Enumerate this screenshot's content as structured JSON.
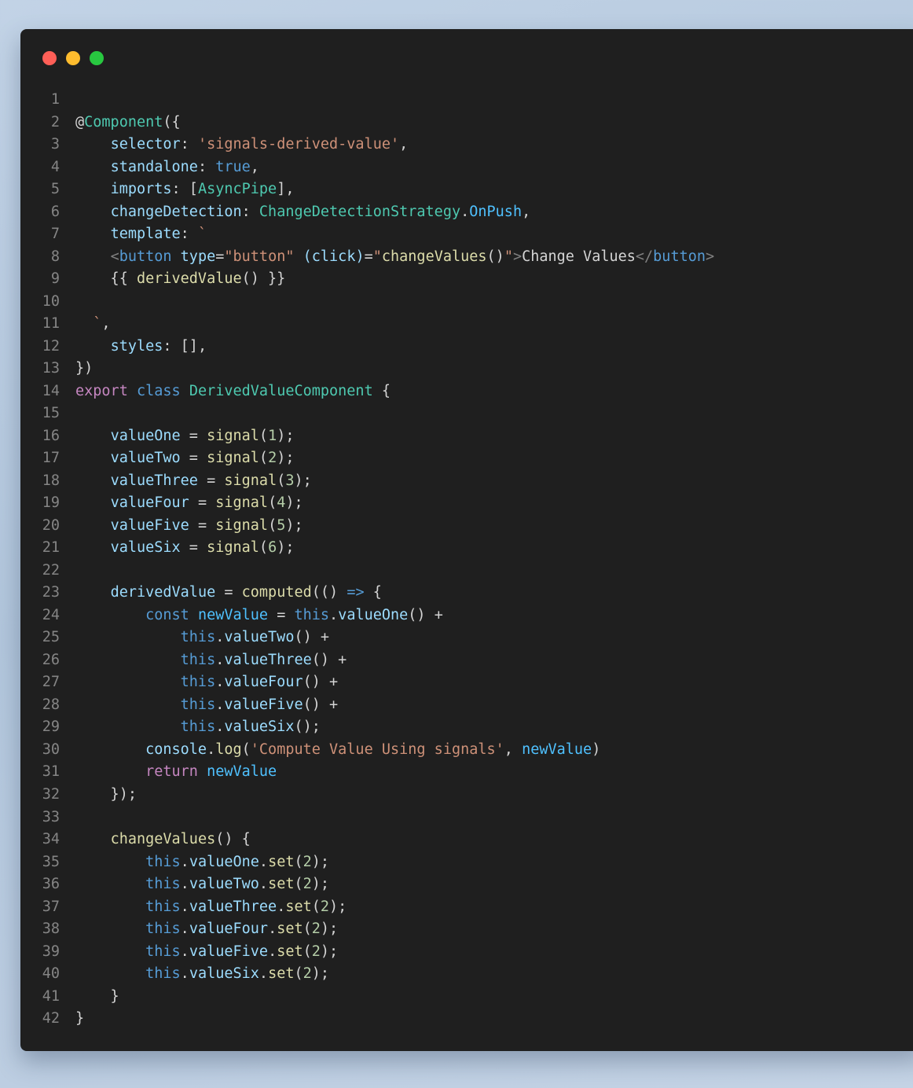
{
  "window": {
    "controls": [
      {
        "name": "close",
        "color": "#ff5f57"
      },
      {
        "name": "minimize",
        "color": "#febc2e"
      },
      {
        "name": "maximize",
        "color": "#28c840"
      }
    ]
  },
  "code": {
    "lines": [
      {
        "num": "1",
        "tokens": []
      },
      {
        "num": "2",
        "tokens": [
          [
            "text",
            "@"
          ],
          [
            "deco",
            "Component"
          ],
          [
            "text",
            "({"
          ]
        ]
      },
      {
        "num": "3",
        "tokens": [
          [
            "text",
            "    "
          ],
          [
            "prop",
            "selector"
          ],
          [
            "text",
            ": "
          ],
          [
            "str",
            "'signals-derived-value'"
          ],
          [
            "text",
            ","
          ]
        ]
      },
      {
        "num": "4",
        "tokens": [
          [
            "text",
            "    "
          ],
          [
            "prop",
            "standalone"
          ],
          [
            "text",
            ": "
          ],
          [
            "kw",
            "true"
          ],
          [
            "text",
            ","
          ]
        ]
      },
      {
        "num": "5",
        "tokens": [
          [
            "text",
            "    "
          ],
          [
            "prop",
            "imports"
          ],
          [
            "text",
            ": ["
          ],
          [
            "type",
            "AsyncPipe"
          ],
          [
            "text",
            "],"
          ]
        ]
      },
      {
        "num": "6",
        "tokens": [
          [
            "text",
            "    "
          ],
          [
            "prop",
            "changeDetection"
          ],
          [
            "text",
            ": "
          ],
          [
            "type",
            "ChangeDetectionStrategy"
          ],
          [
            "text",
            "."
          ],
          [
            "var",
            "OnPush"
          ],
          [
            "text",
            ","
          ]
        ]
      },
      {
        "num": "7",
        "tokens": [
          [
            "text",
            "    "
          ],
          [
            "prop",
            "template"
          ],
          [
            "text",
            ": "
          ],
          [
            "str",
            "`"
          ]
        ]
      },
      {
        "num": "8",
        "tokens": [
          [
            "text",
            "    "
          ],
          [
            "punct",
            "<"
          ],
          [
            "tag",
            "button"
          ],
          [
            "text",
            " "
          ],
          [
            "attr",
            "type"
          ],
          [
            "text",
            "="
          ],
          [
            "str",
            "\"button\""
          ],
          [
            "text",
            " "
          ],
          [
            "attr",
            "(click)"
          ],
          [
            "text",
            "="
          ],
          [
            "str",
            "\""
          ],
          [
            "fn",
            "changeValues"
          ],
          [
            "text",
            "()"
          ],
          [
            "str",
            "\""
          ],
          [
            "punct",
            ">"
          ],
          [
            "text",
            "Change Values"
          ],
          [
            "punct",
            "</"
          ],
          [
            "tag",
            "button"
          ],
          [
            "punct",
            ">"
          ]
        ]
      },
      {
        "num": "9",
        "tokens": [
          [
            "text",
            "    {{ "
          ],
          [
            "fn",
            "derivedValue"
          ],
          [
            "text",
            "() }}"
          ]
        ]
      },
      {
        "num": "10",
        "tokens": []
      },
      {
        "num": "11",
        "tokens": [
          [
            "text",
            "  "
          ],
          [
            "str",
            "`"
          ],
          [
            "text",
            ","
          ]
        ]
      },
      {
        "num": "12",
        "tokens": [
          [
            "text",
            "    "
          ],
          [
            "prop",
            "styles"
          ],
          [
            "text",
            ": [],"
          ]
        ]
      },
      {
        "num": "13",
        "tokens": [
          [
            "text",
            "})"
          ]
        ]
      },
      {
        "num": "14",
        "tokens": [
          [
            "kw2",
            "export"
          ],
          [
            "text",
            " "
          ],
          [
            "kw",
            "class"
          ],
          [
            "text",
            " "
          ],
          [
            "type",
            "DerivedValueComponent"
          ],
          [
            "text",
            " {"
          ]
        ]
      },
      {
        "num": "15",
        "tokens": []
      },
      {
        "num": "16",
        "tokens": [
          [
            "text",
            "    "
          ],
          [
            "prop",
            "valueOne"
          ],
          [
            "text",
            " = "
          ],
          [
            "fn",
            "signal"
          ],
          [
            "text",
            "("
          ],
          [
            "num",
            "1"
          ],
          [
            "text",
            ");"
          ]
        ]
      },
      {
        "num": "17",
        "tokens": [
          [
            "text",
            "    "
          ],
          [
            "prop",
            "valueTwo"
          ],
          [
            "text",
            " = "
          ],
          [
            "fn",
            "signal"
          ],
          [
            "text",
            "("
          ],
          [
            "num",
            "2"
          ],
          [
            "text",
            ");"
          ]
        ]
      },
      {
        "num": "18",
        "tokens": [
          [
            "text",
            "    "
          ],
          [
            "prop",
            "valueThree"
          ],
          [
            "text",
            " = "
          ],
          [
            "fn",
            "signal"
          ],
          [
            "text",
            "("
          ],
          [
            "num",
            "3"
          ],
          [
            "text",
            ");"
          ]
        ]
      },
      {
        "num": "19",
        "tokens": [
          [
            "text",
            "    "
          ],
          [
            "prop",
            "valueFour"
          ],
          [
            "text",
            " = "
          ],
          [
            "fn",
            "signal"
          ],
          [
            "text",
            "("
          ],
          [
            "num",
            "4"
          ],
          [
            "text",
            ");"
          ]
        ]
      },
      {
        "num": "20",
        "tokens": [
          [
            "text",
            "    "
          ],
          [
            "prop",
            "valueFive"
          ],
          [
            "text",
            " = "
          ],
          [
            "fn",
            "signal"
          ],
          [
            "text",
            "("
          ],
          [
            "num",
            "5"
          ],
          [
            "text",
            ");"
          ]
        ]
      },
      {
        "num": "21",
        "tokens": [
          [
            "text",
            "    "
          ],
          [
            "prop",
            "valueSix"
          ],
          [
            "text",
            " = "
          ],
          [
            "fn",
            "signal"
          ],
          [
            "text",
            "("
          ],
          [
            "num",
            "6"
          ],
          [
            "text",
            ");"
          ]
        ]
      },
      {
        "num": "22",
        "tokens": []
      },
      {
        "num": "23",
        "tokens": [
          [
            "text",
            "    "
          ],
          [
            "prop",
            "derivedValue"
          ],
          [
            "text",
            " = "
          ],
          [
            "fn",
            "computed"
          ],
          [
            "text",
            "(() "
          ],
          [
            "kw",
            "=>"
          ],
          [
            "text",
            " {"
          ]
        ]
      },
      {
        "num": "24",
        "tokens": [
          [
            "text",
            "        "
          ],
          [
            "kw",
            "const"
          ],
          [
            "text",
            " "
          ],
          [
            "var",
            "newValue"
          ],
          [
            "text",
            " = "
          ],
          [
            "kw",
            "this"
          ],
          [
            "text",
            "."
          ],
          [
            "prop",
            "valueOne"
          ],
          [
            "text",
            "() +"
          ]
        ]
      },
      {
        "num": "25",
        "tokens": [
          [
            "text",
            "            "
          ],
          [
            "kw",
            "this"
          ],
          [
            "text",
            "."
          ],
          [
            "prop",
            "valueTwo"
          ],
          [
            "text",
            "() +"
          ]
        ]
      },
      {
        "num": "26",
        "tokens": [
          [
            "text",
            "            "
          ],
          [
            "kw",
            "this"
          ],
          [
            "text",
            "."
          ],
          [
            "prop",
            "valueThree"
          ],
          [
            "text",
            "() +"
          ]
        ]
      },
      {
        "num": "27",
        "tokens": [
          [
            "text",
            "            "
          ],
          [
            "kw",
            "this"
          ],
          [
            "text",
            "."
          ],
          [
            "prop",
            "valueFour"
          ],
          [
            "text",
            "() +"
          ]
        ]
      },
      {
        "num": "28",
        "tokens": [
          [
            "text",
            "            "
          ],
          [
            "kw",
            "this"
          ],
          [
            "text",
            "."
          ],
          [
            "prop",
            "valueFive"
          ],
          [
            "text",
            "() +"
          ]
        ]
      },
      {
        "num": "29",
        "tokens": [
          [
            "text",
            "            "
          ],
          [
            "kw",
            "this"
          ],
          [
            "text",
            "."
          ],
          [
            "prop",
            "valueSix"
          ],
          [
            "text",
            "();"
          ]
        ]
      },
      {
        "num": "30",
        "tokens": [
          [
            "text",
            "        "
          ],
          [
            "prop",
            "console"
          ],
          [
            "text",
            "."
          ],
          [
            "fn",
            "log"
          ],
          [
            "text",
            "("
          ],
          [
            "str",
            "'Compute Value Using signals'"
          ],
          [
            "text",
            ", "
          ],
          [
            "var",
            "newValue"
          ],
          [
            "text",
            ")"
          ]
        ]
      },
      {
        "num": "31",
        "tokens": [
          [
            "text",
            "        "
          ],
          [
            "kw2",
            "return"
          ],
          [
            "text",
            " "
          ],
          [
            "var",
            "newValue"
          ]
        ]
      },
      {
        "num": "32",
        "tokens": [
          [
            "text",
            "    });"
          ]
        ]
      },
      {
        "num": "33",
        "tokens": []
      },
      {
        "num": "34",
        "tokens": [
          [
            "text",
            "    "
          ],
          [
            "fn",
            "changeValues"
          ],
          [
            "text",
            "() {"
          ]
        ]
      },
      {
        "num": "35",
        "tokens": [
          [
            "text",
            "        "
          ],
          [
            "kw",
            "this"
          ],
          [
            "text",
            "."
          ],
          [
            "prop",
            "valueOne"
          ],
          [
            "text",
            "."
          ],
          [
            "fn",
            "set"
          ],
          [
            "text",
            "("
          ],
          [
            "num",
            "2"
          ],
          [
            "text",
            ");"
          ]
        ]
      },
      {
        "num": "36",
        "tokens": [
          [
            "text",
            "        "
          ],
          [
            "kw",
            "this"
          ],
          [
            "text",
            "."
          ],
          [
            "prop",
            "valueTwo"
          ],
          [
            "text",
            "."
          ],
          [
            "fn",
            "set"
          ],
          [
            "text",
            "("
          ],
          [
            "num",
            "2"
          ],
          [
            "text",
            ");"
          ]
        ]
      },
      {
        "num": "37",
        "tokens": [
          [
            "text",
            "        "
          ],
          [
            "kw",
            "this"
          ],
          [
            "text",
            "."
          ],
          [
            "prop",
            "valueThree"
          ],
          [
            "text",
            "."
          ],
          [
            "fn",
            "set"
          ],
          [
            "text",
            "("
          ],
          [
            "num",
            "2"
          ],
          [
            "text",
            ");"
          ]
        ]
      },
      {
        "num": "38",
        "tokens": [
          [
            "text",
            "        "
          ],
          [
            "kw",
            "this"
          ],
          [
            "text",
            "."
          ],
          [
            "prop",
            "valueFour"
          ],
          [
            "text",
            "."
          ],
          [
            "fn",
            "set"
          ],
          [
            "text",
            "("
          ],
          [
            "num",
            "2"
          ],
          [
            "text",
            ");"
          ]
        ]
      },
      {
        "num": "39",
        "tokens": [
          [
            "text",
            "        "
          ],
          [
            "kw",
            "this"
          ],
          [
            "text",
            "."
          ],
          [
            "prop",
            "valueFive"
          ],
          [
            "text",
            "."
          ],
          [
            "fn",
            "set"
          ],
          [
            "text",
            "("
          ],
          [
            "num",
            "2"
          ],
          [
            "text",
            ");"
          ]
        ]
      },
      {
        "num": "40",
        "tokens": [
          [
            "text",
            "        "
          ],
          [
            "kw",
            "this"
          ],
          [
            "text",
            "."
          ],
          [
            "prop",
            "valueSix"
          ],
          [
            "text",
            "."
          ],
          [
            "fn",
            "set"
          ],
          [
            "text",
            "("
          ],
          [
            "num",
            "2"
          ],
          [
            "text",
            ");"
          ]
        ]
      },
      {
        "num": "41",
        "tokens": [
          [
            "text",
            "    }"
          ]
        ]
      },
      {
        "num": "42",
        "tokens": [
          [
            "text",
            "}"
          ]
        ]
      }
    ]
  }
}
